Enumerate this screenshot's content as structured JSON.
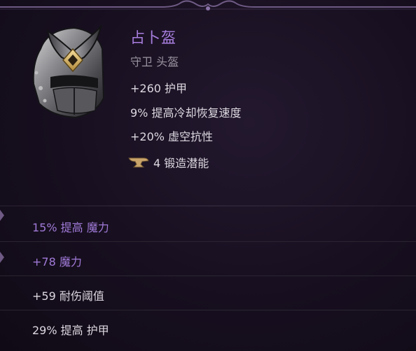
{
  "item": {
    "name": "占卜盔",
    "type": "守卫 头盔",
    "implicits": [
      "+260 护甲",
      "9% 提高冷却恢复速度",
      "+20% 虚空抗性"
    ],
    "forge": {
      "icon": "anvil-icon",
      "text": "4 锻造潜能"
    },
    "affixes": [
      {
        "text": "15% 提高 魔力",
        "rarity": "magic"
      },
      {
        "text": "+78 魔力",
        "rarity": "magic"
      },
      {
        "text": "+59 耐伤阈值",
        "rarity": "normal"
      },
      {
        "text": "29% 提高 护甲",
        "rarity": "normal"
      }
    ]
  },
  "colors": {
    "name": "#a97fe0",
    "magic_affix": "#a07ad8",
    "normal_text": "#dcd8e0",
    "type_text": "#9a94a0",
    "background": "#170f1f"
  }
}
